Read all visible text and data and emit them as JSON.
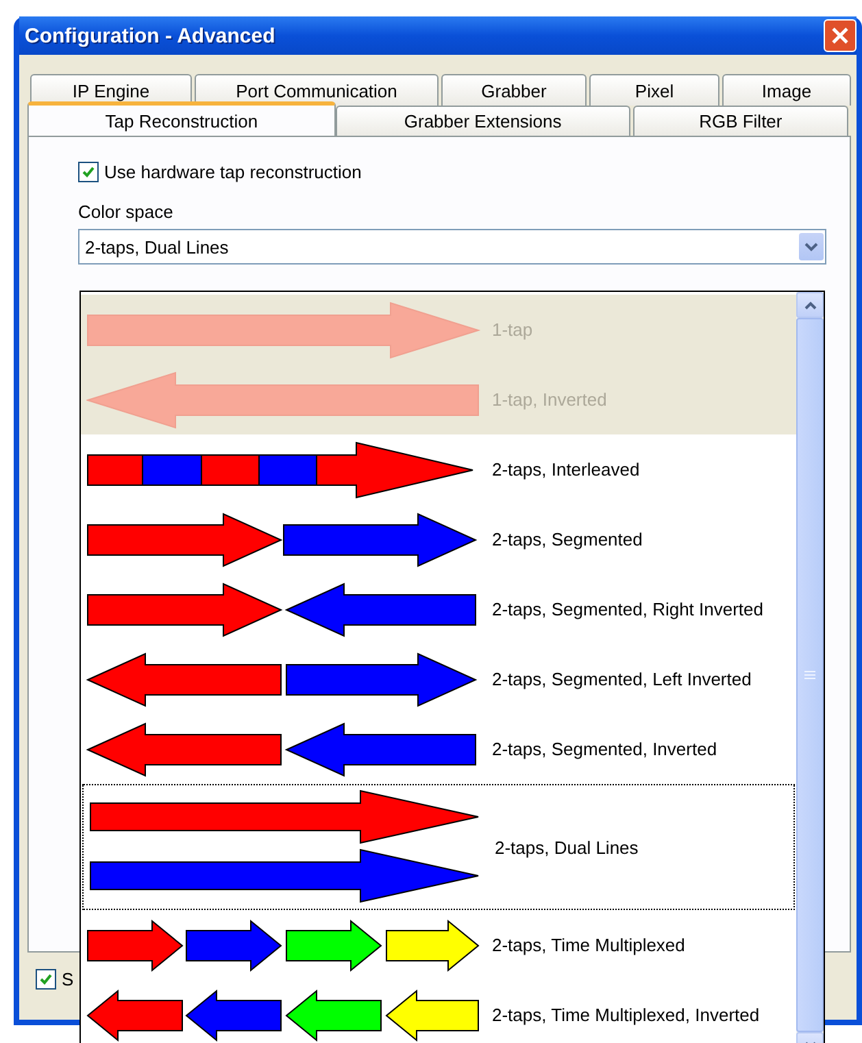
{
  "window": {
    "title": "Configuration - Advanced"
  },
  "tab_rows": [
    [
      {
        "label": "IP Engine",
        "selected": false
      },
      {
        "label": "Port Communication",
        "selected": false
      },
      {
        "label": "Grabber",
        "selected": false
      },
      {
        "label": "Pixel",
        "selected": false
      },
      {
        "label": "Image",
        "selected": false
      }
    ],
    [
      {
        "label": "Tap Reconstruction",
        "selected": true
      },
      {
        "label": "Grabber Extensions",
        "selected": false
      },
      {
        "label": "RGB Filter",
        "selected": false
      }
    ]
  ],
  "hardware_tap": {
    "label": "Use hardware tap reconstruction",
    "checked": true
  },
  "color_space": {
    "label": "Color space",
    "value": "2-taps, Dual Lines",
    "options": [
      {
        "label": "1-tap",
        "kind": "single",
        "disabled": true,
        "selected": false
      },
      {
        "label": "1-tap, Inverted",
        "kind": "single-inverted",
        "disabled": true,
        "selected": false
      },
      {
        "label": "2-taps, Interleaved",
        "kind": "interleaved",
        "disabled": false,
        "selected": false
      },
      {
        "label": "2-taps, Segmented",
        "kind": "segmented",
        "disabled": false,
        "selected": false
      },
      {
        "label": "2-taps, Segmented, Right Inverted",
        "kind": "segmented-right-inverted",
        "disabled": false,
        "selected": false
      },
      {
        "label": "2-taps, Segmented, Left Inverted",
        "kind": "segmented-left-inverted",
        "disabled": false,
        "selected": false
      },
      {
        "label": "2-taps, Segmented, Inverted",
        "kind": "segmented-inverted",
        "disabled": false,
        "selected": false
      },
      {
        "label": "2-taps, Dual Lines",
        "kind": "dual-lines",
        "disabled": false,
        "selected": true
      },
      {
        "label": "2-taps, Time Multiplexed",
        "kind": "time-multiplexed",
        "disabled": false,
        "selected": false
      },
      {
        "label": "2-taps, Time Multiplexed, Inverted",
        "kind": "time-multiplexed-inverted",
        "disabled": false,
        "selected": false
      }
    ]
  },
  "bottom_checkbox": {
    "label": "S",
    "checked": true
  }
}
